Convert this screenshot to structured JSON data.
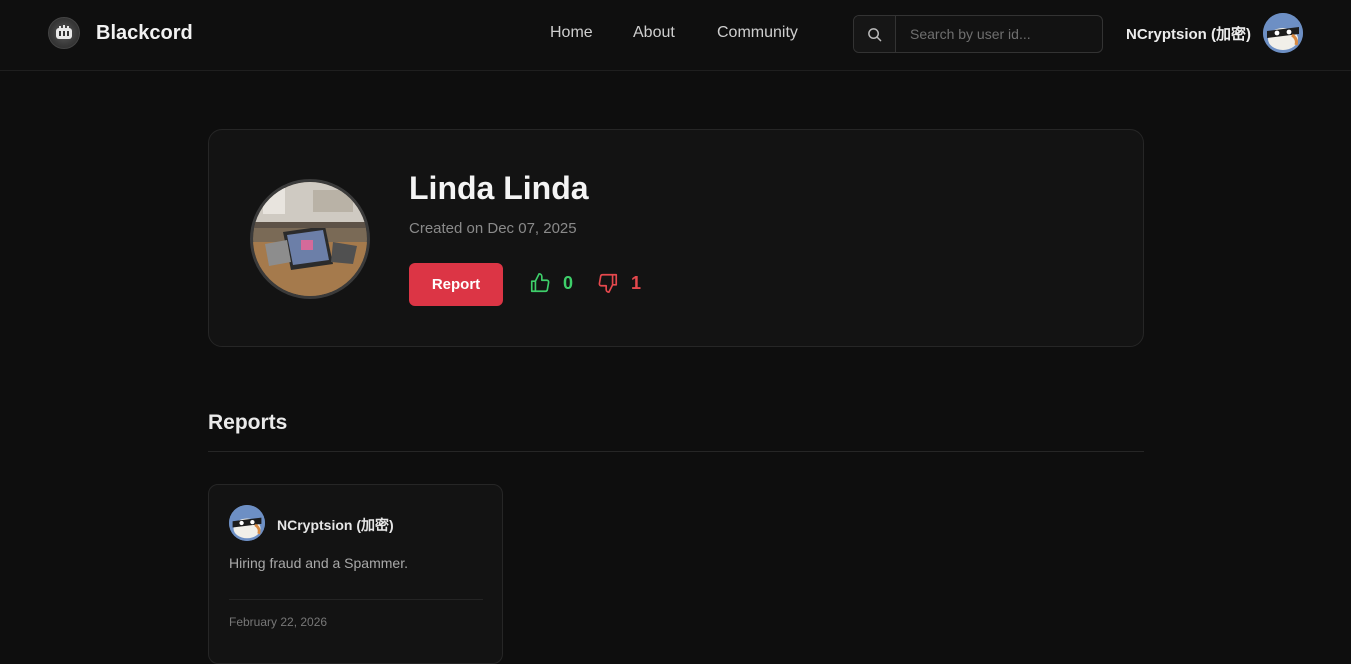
{
  "header": {
    "brand_name": "Blackcord",
    "nav": [
      {
        "label": "Home"
      },
      {
        "label": "About"
      },
      {
        "label": "Community"
      }
    ],
    "search": {
      "placeholder": "Search by user id...",
      "value": ""
    },
    "current_user": "NCryptsion (加密)"
  },
  "profile": {
    "name": "Linda Linda",
    "created": "Created on Dec 07, 2025",
    "report_label": "Report",
    "upvotes": "0",
    "downvotes": "1"
  },
  "reports_section": {
    "title": "Reports",
    "items": [
      {
        "author": "NCryptsion (加密)",
        "text": "Hiring fraud and a Spammer.",
        "date": "February 22, 2026"
      }
    ]
  },
  "colors": {
    "accent_red": "#dc3545",
    "up_green": "#3ecf6a",
    "down_red": "#e5484d",
    "background": "#0e0e0e"
  }
}
